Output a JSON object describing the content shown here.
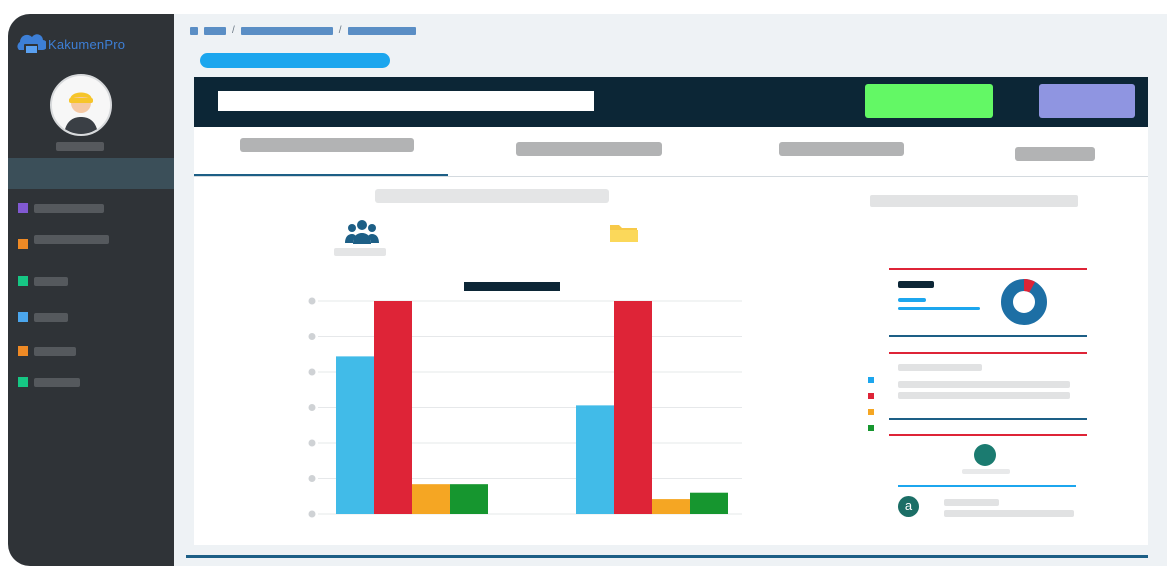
{
  "app": {
    "name": "KakumenPro"
  },
  "icons": {
    "logo": "cloud-folder-icon",
    "users": "users-icon",
    "folder": "folder-icon",
    "avatar": "user-avatar",
    "note_badge": "a"
  },
  "colors": {
    "sidebar": "#2f3337",
    "topbar": "#0c2636",
    "accent_blue": "#1ca6ee",
    "green_button": "#63f865",
    "purple_button": "#8f95e1"
  },
  "sidebar": {
    "items": [
      {
        "color": "#8159d2"
      },
      {
        "color": "#ef8a25"
      },
      {
        "color": "#16c784"
      },
      {
        "color": "#4ba6ec"
      },
      {
        "color": "#ef8a25"
      },
      {
        "color": "#16c784"
      }
    ]
  },
  "chart_data": {
    "type": "bar",
    "categories": [
      "",
      ""
    ],
    "series": [
      {
        "color": "#41bbe8",
        "values": [
          74,
          51
        ]
      },
      {
        "color": "#de2437",
        "values": [
          100,
          100
        ]
      },
      {
        "color": "#f5a623",
        "values": [
          14,
          7
        ]
      },
      {
        "color": "#16962f",
        "values": [
          14,
          10
        ]
      }
    ],
    "ylim": [
      0,
      100
    ],
    "grid": true,
    "legend": "none"
  },
  "donut": {
    "value": 0.92,
    "colors": [
      "#1d6fa5",
      "#de2437"
    ]
  },
  "legend_colors": [
    "#1ca6ee",
    "#de2437",
    "#f5a623",
    "#16962f"
  ]
}
